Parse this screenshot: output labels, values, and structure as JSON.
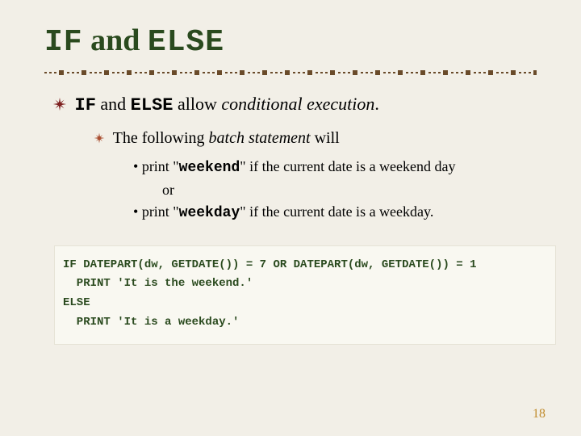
{
  "title": {
    "kw1": "IF",
    "mid": " and ",
    "kw2": "ELSE"
  },
  "lvl1": {
    "kw1": "IF",
    "mid": " and ",
    "kw2": "ELSE",
    "rest": " allow ",
    "italic": "conditional execution",
    "end": "."
  },
  "lvl2": {
    "pre": "The following ",
    "italic": "batch statement",
    "post": " will"
  },
  "lvl3": {
    "b1a": "print \"",
    "b1kw": "weekend",
    "b1b": "\" if the current date is a weekend day",
    "or": "or",
    "b2a": "print \"",
    "b2kw": "weekday",
    "b2b": "\" if the current date is a weekday."
  },
  "code": {
    "l1": "IF DATEPART(dw, GETDATE()) = 7 OR DATEPART(dw, GETDATE()) = 1",
    "l2": "  PRINT 'It is the weekend.'",
    "l3": "ELSE",
    "l4": "  PRINT 'It is a weekday.'"
  },
  "page": "18"
}
